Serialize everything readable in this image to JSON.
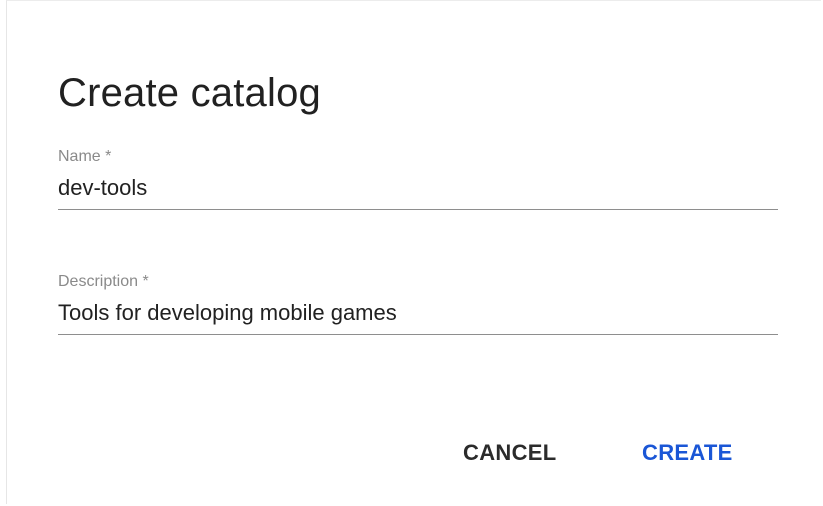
{
  "dialog": {
    "title": "Create catalog",
    "fields": {
      "name": {
        "label": "Name *",
        "value": "dev-tools"
      },
      "description": {
        "label": "Description *",
        "value": "Tools for developing mobile games"
      }
    },
    "actions": {
      "cancel_label": "CANCEL",
      "create_label": "CREATE"
    }
  },
  "colors": {
    "primary_action": "#1a56d6",
    "text": "#212121",
    "label": "#8a8a8a",
    "underline": "#8e8e8e"
  }
}
